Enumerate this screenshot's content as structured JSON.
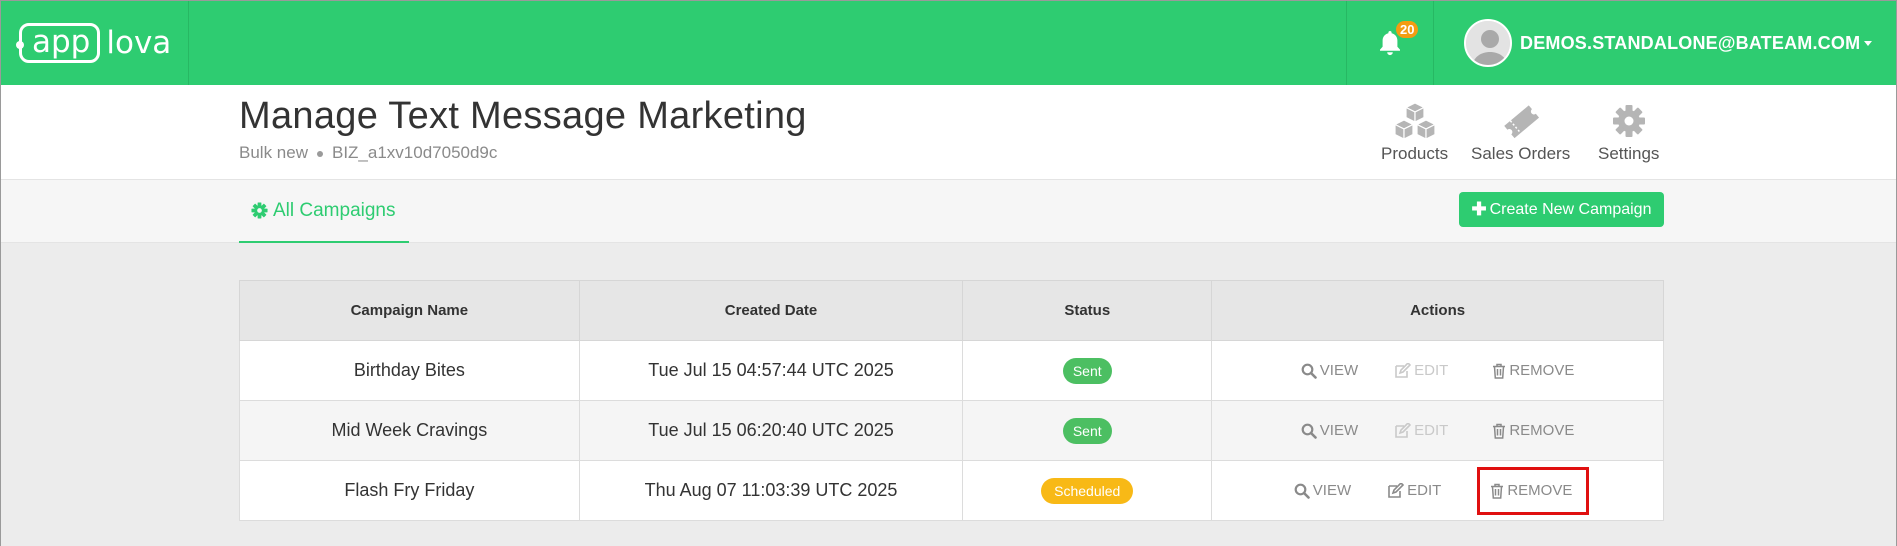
{
  "brand": {
    "logo_part1": "app",
    "logo_part2": "lova",
    "primary_color": "#2ecc71",
    "badge_color": "#f39c12"
  },
  "topbar": {
    "notification_count": "20",
    "notification_icon": "bell-icon",
    "user_email": "DEMOS.STANDALONE@BATEAM.COM"
  },
  "header": {
    "title": "Manage Text Message Marketing",
    "subtitle_left": "Bulk new",
    "subtitle_right": "BIZ_a1xv10d7050d9c",
    "shortcuts": [
      {
        "label": "Products",
        "icon": "cubes-icon"
      },
      {
        "label": "Sales Orders",
        "icon": "ticket-icon"
      },
      {
        "label": "Settings",
        "icon": "gear-icon"
      }
    ]
  },
  "tabs": {
    "active_label": "All Campaigns",
    "create_button_label": "Create New Campaign"
  },
  "table": {
    "columns": [
      "Campaign Name",
      "Created Date",
      "Status",
      "Actions"
    ],
    "rows": [
      {
        "name": "Birthday Bites",
        "created": "Tue Jul 15 04:57:44 UTC 2025",
        "status": "Sent",
        "edit_enabled": false
      },
      {
        "name": "Mid Week Cravings",
        "created": "Tue Jul 15 06:20:40 UTC 2025",
        "status": "Sent",
        "edit_enabled": false
      },
      {
        "name": "Flash Fry Friday",
        "created": "Thu Aug 07 11:03:39 UTC 2025",
        "status": "Scheduled",
        "edit_enabled": true
      }
    ],
    "action_labels": {
      "view": "VIEW",
      "edit": "EDIT",
      "remove": "REMOVE"
    },
    "status_colors": {
      "Sent": "#4cbf62",
      "Scheduled": "#f8b916"
    }
  }
}
